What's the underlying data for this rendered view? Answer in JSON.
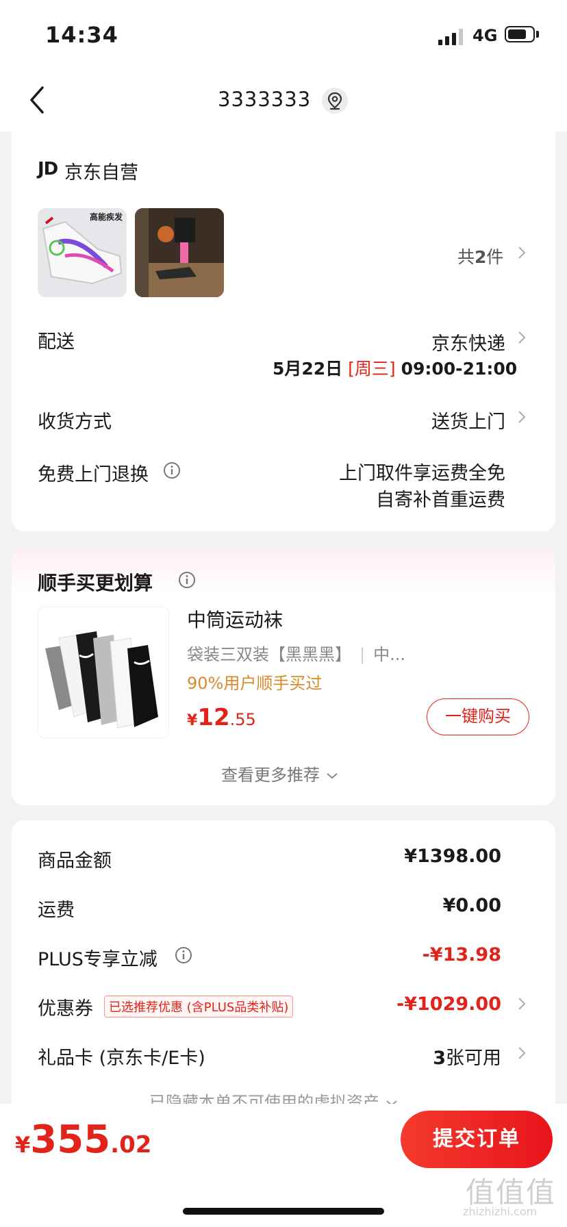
{
  "status_bar": {
    "time": "14:34",
    "network": "4G"
  },
  "nav": {
    "title": "3333333"
  },
  "shop": {
    "logo": "JD",
    "name": "京东自营",
    "count_prefix": "共",
    "count_num": "2",
    "count_suffix": "件",
    "product1_badge": "高能疾发"
  },
  "delivery": {
    "label": "配送",
    "carrier": "京东快递",
    "date": "5月22日",
    "weekday": "[周三]",
    "time": "09:00-21:00"
  },
  "receive": {
    "label": "收货方式",
    "value": "送货上门"
  },
  "returns": {
    "label": "免费上门退换",
    "line1": "上门取件享运费全免",
    "line2": "自寄补首重运费"
  },
  "recommend": {
    "title": "顺手买更划算",
    "product_name": "中筒运动袜",
    "spec": "袋装三双装【黑黑黑】",
    "spec_more": "中...",
    "popularity": "90%用户顺手买过",
    "price_symbol": "¥",
    "price_int": "12",
    "price_dec": ".55",
    "buy_button": "一键购买",
    "more": "查看更多推荐"
  },
  "summary": {
    "goods_label": "商品金额",
    "goods_value": "¥1398.00",
    "freight_label": "运费",
    "freight_value": "¥0.00",
    "plus_label": "PLUS专享立减",
    "plus_value": "-¥13.98",
    "coupon_label": "优惠券",
    "coupon_tag": "已选推荐优惠 (含PLUS品类补贴)",
    "coupon_value": "-¥1029.00",
    "gift_label": "礼品卡 (京东卡/E卡)",
    "gift_count": "3",
    "gift_suffix": "张可用",
    "hidden_note": "已隐藏本单不可使用的虚拟资产"
  },
  "footer": {
    "total_symbol": "¥",
    "total_int": "355",
    "total_dec": ".02",
    "submit": "提交订单",
    "watermark": "值值值",
    "watermark_sub": "zhizhizhi.com"
  },
  "colors": {
    "accent": "#e2231a",
    "popularity": "#d98a2b"
  }
}
